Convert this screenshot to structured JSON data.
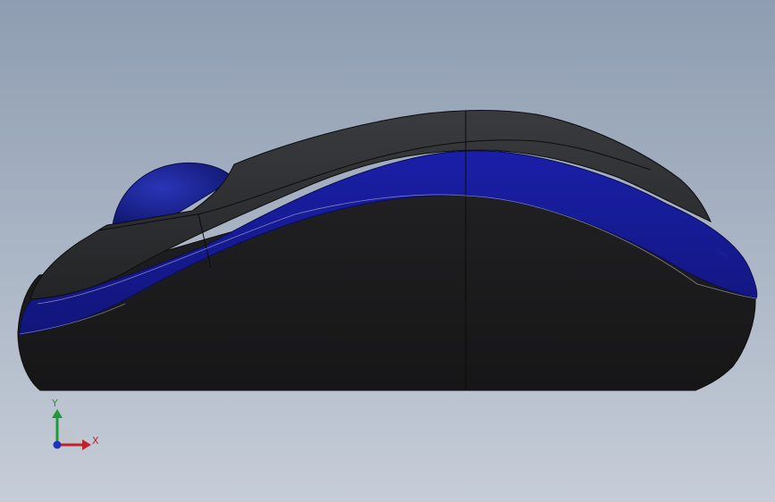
{
  "viewport": {
    "background_top": "#8e9db1",
    "background_bottom": "#c6cdd8"
  },
  "model": {
    "body_color": "#1c1c1e",
    "shell_color": "#2f3033",
    "stripe_color": "#1a1f9c",
    "stripe_highlight": "#3a45d8",
    "wheel_color": "#1b2590",
    "edge_color": "#0d0d0d"
  },
  "triad": {
    "x_label": "X",
    "y_label": "Y",
    "x_color": "#c0202a",
    "y_color": "#1f9a3a",
    "z_color": "#2030c0"
  }
}
